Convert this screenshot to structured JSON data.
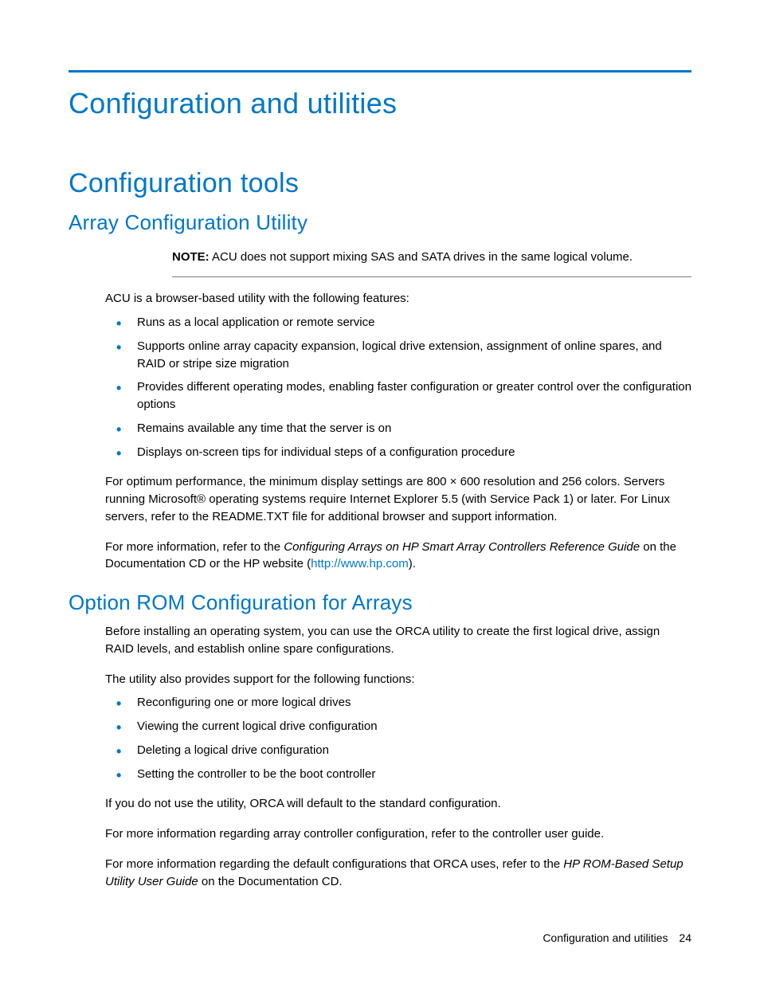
{
  "chapter_title": "Configuration and utilities",
  "section_title": "Configuration tools",
  "acu": {
    "heading": "Array Configuration Utility",
    "note_label": "NOTE:",
    "note_text": "ACU does not support mixing SAS and SATA drives in the same logical volume.",
    "intro": "ACU is a browser-based utility with the following features:",
    "bullets": [
      "Runs as a local application or remote service",
      "Supports online array capacity expansion, logical drive extension, assignment of online spares, and RAID or stripe size migration",
      "Provides different operating modes, enabling faster configuration or greater control over the configuration options",
      "Remains available any time that the server is on",
      "Displays on-screen tips for individual steps of a configuration procedure"
    ],
    "perf": "For optimum performance, the minimum display settings are 800 × 600 resolution and 256 colors. Servers running Microsoft® operating systems require Internet Explorer 5.5 (with Service Pack 1) or later. For Linux servers, refer to the README.TXT file for additional browser and support information.",
    "moreinfo_pre": "For more information, refer to the ",
    "moreinfo_guide": "Configuring Arrays on HP Smart Array Controllers Reference Guide",
    "moreinfo_mid": " on the Documentation CD or the HP website (",
    "moreinfo_link": "http://www.hp.com",
    "moreinfo_post": ")."
  },
  "orca": {
    "heading": "Option ROM Configuration for Arrays",
    "intro": "Before installing an operating system, you can use the ORCA utility to create the first logical drive, assign RAID levels, and establish online spare configurations.",
    "support_line": "The utility also provides support for the following functions:",
    "bullets": [
      "Reconfiguring one or more logical drives",
      "Viewing the current logical drive configuration",
      "Deleting a logical drive configuration",
      "Setting the controller to be the boot controller"
    ],
    "default_line": "If you do not use the utility, ORCA will default to the standard configuration.",
    "controller_line": "For more information regarding array controller configuration, refer to the controller user guide.",
    "rom_pre": "For more information regarding the default configurations that ORCA uses, refer to the ",
    "rom_guide": "HP ROM-Based Setup Utility User Guide",
    "rom_post": " on the Documentation CD."
  },
  "footer": {
    "label": "Configuration and utilities",
    "page": "24"
  }
}
